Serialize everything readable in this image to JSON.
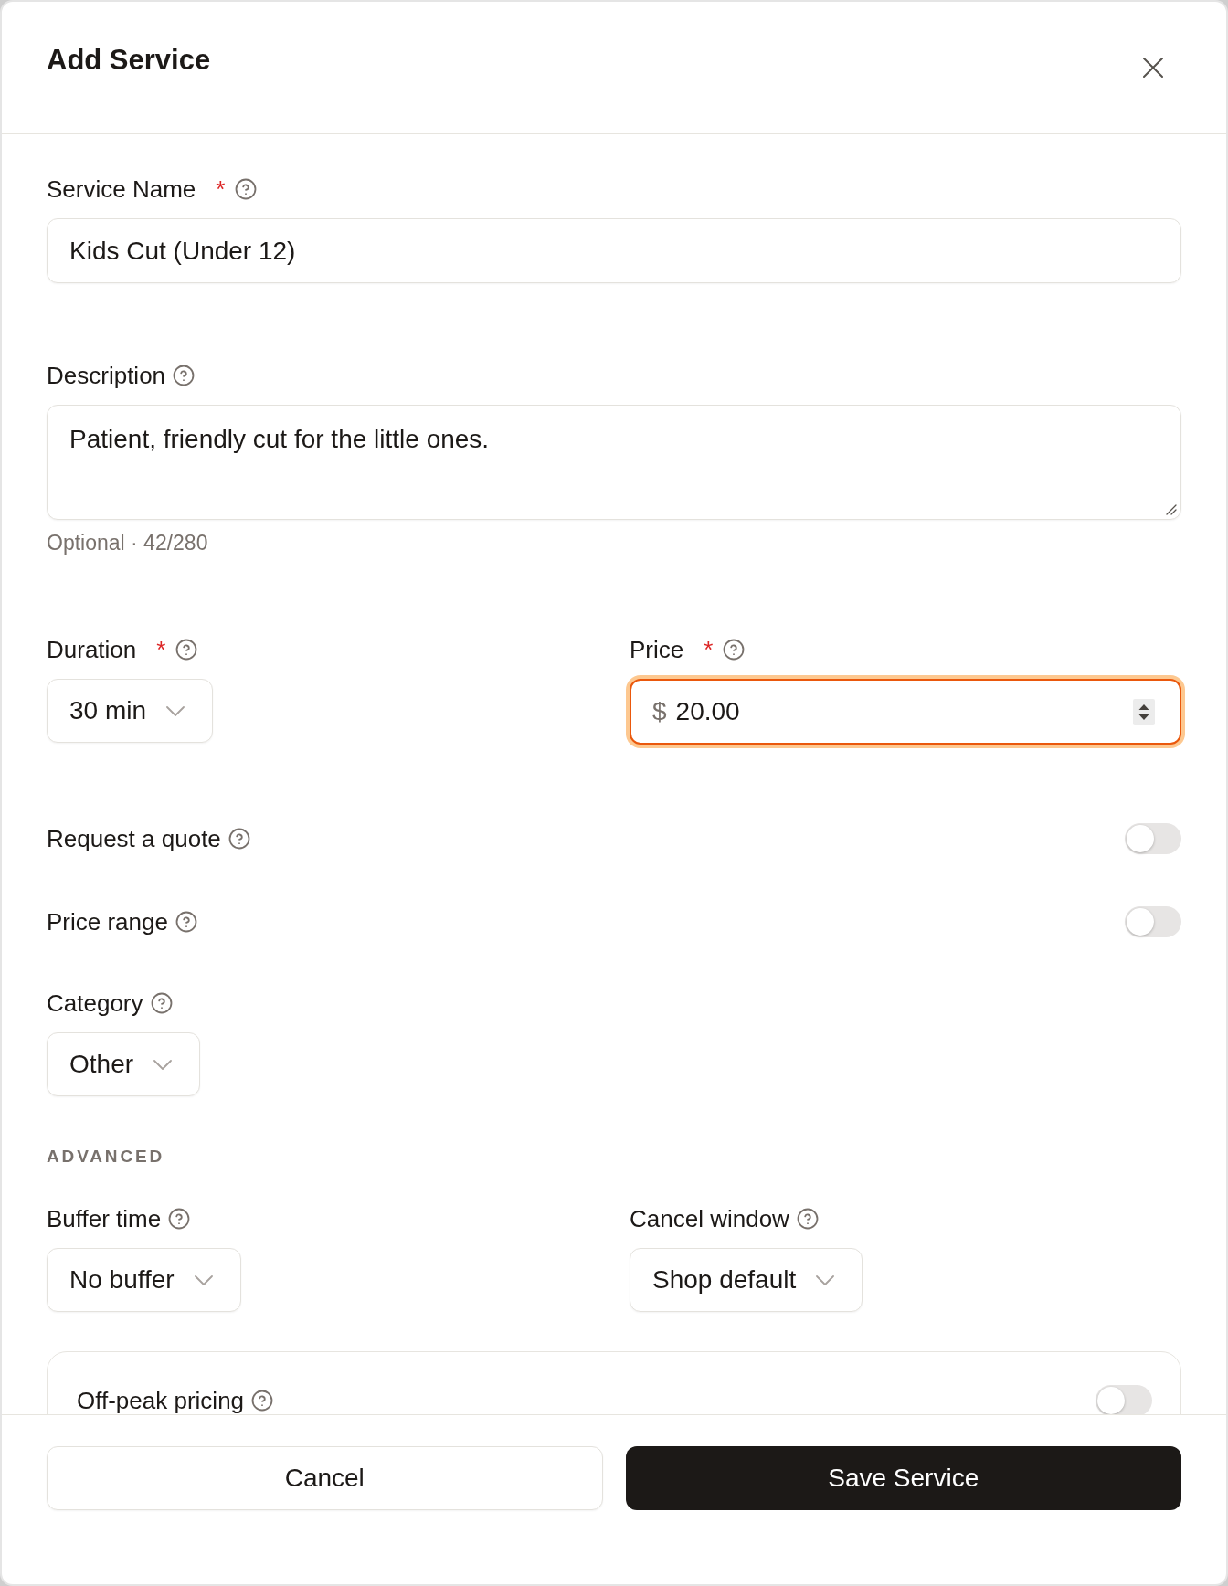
{
  "dialog": {
    "title": "Add Service"
  },
  "fields": [
    {
      "kind": "text",
      "label": "Service Name",
      "required_mark": "*",
      "value": "Kids Cut (Under 12)",
      "focused": false
    },
    {
      "kind": "textarea",
      "label": "Description",
      "value": "Patient, friendly cut for the little ones.",
      "hint": "Optional · 42/280",
      "focused": false
    },
    {
      "kind": "pair",
      "items": [
        {
          "kind": "select",
          "label": "Duration",
          "required_mark": "*",
          "value": "30 min"
        },
        {
          "kind": "number",
          "label": "Price",
          "required_mark": "*",
          "prefix": "$",
          "value": "20.00",
          "focused": true
        }
      ]
    },
    {
      "kind": "toggle",
      "label": "Request a quote",
      "on": false
    },
    {
      "kind": "toggle",
      "label": "Price range",
      "on": false
    },
    {
      "kind": "select",
      "label": "Category",
      "value": "Other"
    },
    {
      "kind": "heading",
      "label": "ADVANCED"
    },
    {
      "kind": "pair",
      "items": [
        {
          "kind": "select",
          "label": "Buffer time",
          "value": "No buffer"
        },
        {
          "kind": "select",
          "label": "Cancel window",
          "value": "Shop default"
        }
      ]
    },
    {
      "kind": "card",
      "label": "Off-peak pricing",
      "on": false
    }
  ],
  "footer": {
    "buttons": [
      {
        "kind": "secondary",
        "label": "Cancel"
      },
      {
        "kind": "primary",
        "label": "Save Service"
      }
    ]
  }
}
